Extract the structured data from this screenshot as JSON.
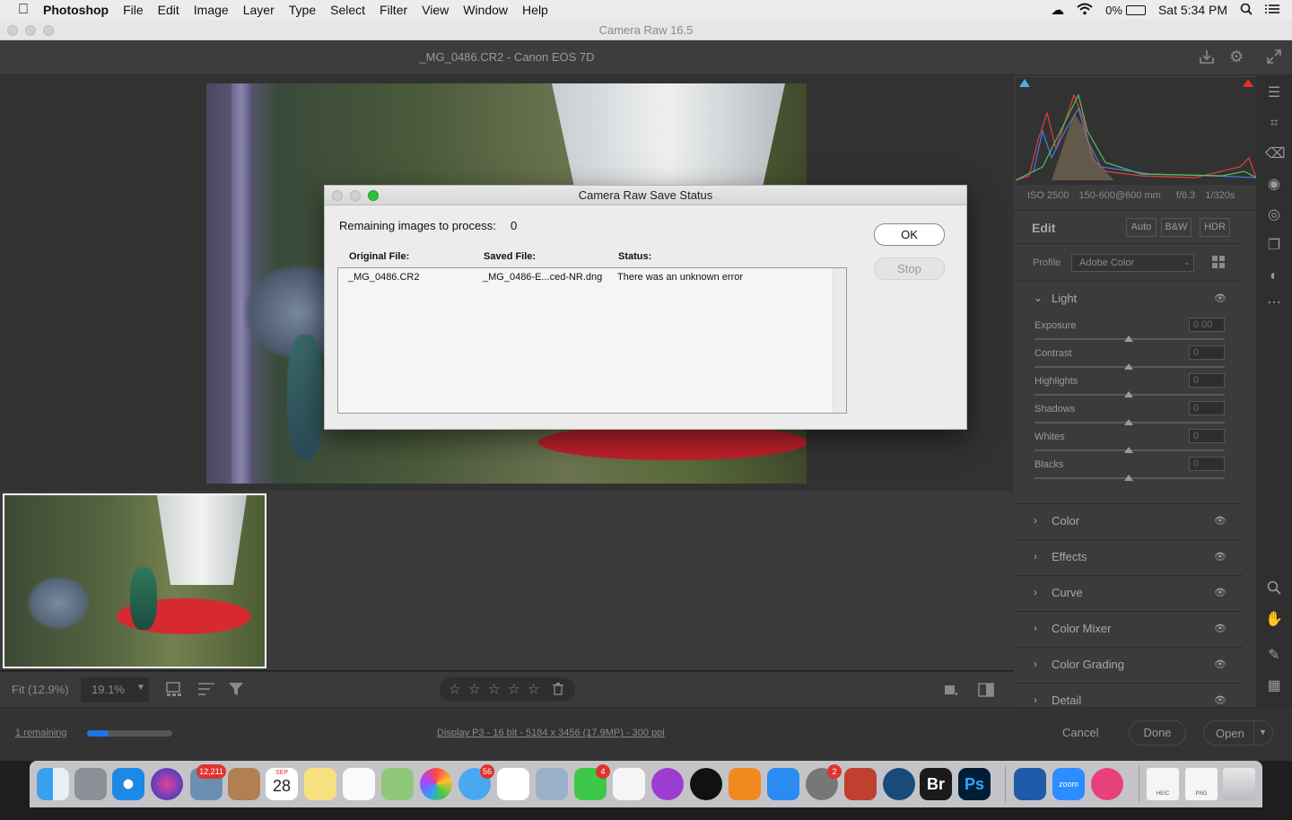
{
  "menubar": {
    "apple_icon": "apple-icon",
    "items": [
      "Photoshop",
      "File",
      "Edit",
      "Image",
      "Layer",
      "Type",
      "Select",
      "Filter",
      "View",
      "Window",
      "Help"
    ],
    "battery": "0%",
    "clock": "Sat 5:34 PM"
  },
  "window": {
    "title": "Camera Raw 16.5"
  },
  "header": {
    "file_info": "_MG_0486.CR2  -  Canon EOS 7D"
  },
  "histogram": {
    "exif": [
      "ISO 2500",
      "150-600@600 mm",
      "f/6.3",
      "1/320s"
    ]
  },
  "edit_panel": {
    "title": "Edit",
    "buttons": [
      "Auto",
      "B&W",
      "HDR"
    ],
    "profile_label": "Profile",
    "profile_value": "Adobe Color",
    "light": {
      "title": "Light",
      "sliders": [
        {
          "label": "Exposure",
          "value": "0.00"
        },
        {
          "label": "Contrast",
          "value": "0"
        },
        {
          "label": "Highlights",
          "value": "0"
        },
        {
          "label": "Shadows",
          "value": "0"
        },
        {
          "label": "Whites",
          "value": "0"
        },
        {
          "label": "Blacks",
          "value": "0"
        }
      ]
    },
    "sections": [
      "Color",
      "Effects",
      "Curve",
      "Color Mixer",
      "Color Grading",
      "Detail"
    ]
  },
  "bottom_toolbar": {
    "fit": "Fit (12.9%)",
    "zoom": "19.1%"
  },
  "statusbar": {
    "remaining": "1 remaining",
    "progress": 0.25,
    "workflow": "Display P3 - 16 bit - 5184 x 3456 (17.9MP) - 300 ppi",
    "cancel": "Cancel",
    "done": "Done",
    "open": "Open"
  },
  "dialog": {
    "title": "Camera Raw Save Status",
    "remaining_label": "Remaining images to process:",
    "remaining_value": "0",
    "columns": [
      "Original File:",
      "Saved File:",
      "Status:"
    ],
    "rows": [
      {
        "original": "_MG_0486.CR2",
        "saved": "_MG_0486-E...ced-NR.dng",
        "status": "There was an unknown error"
      }
    ],
    "ok": "OK",
    "stop": "Stop"
  },
  "dock": {
    "badges": {
      "photos_count": "12,211",
      "messages": "56",
      "facetime": "4",
      "system_prefs": "2"
    },
    "calendar": {
      "month": "SEP",
      "day": "28"
    },
    "bridge": "Br",
    "photoshop": "Ps",
    "zoom": "zoom",
    "heic": "HEIC",
    "png": "PNG"
  }
}
